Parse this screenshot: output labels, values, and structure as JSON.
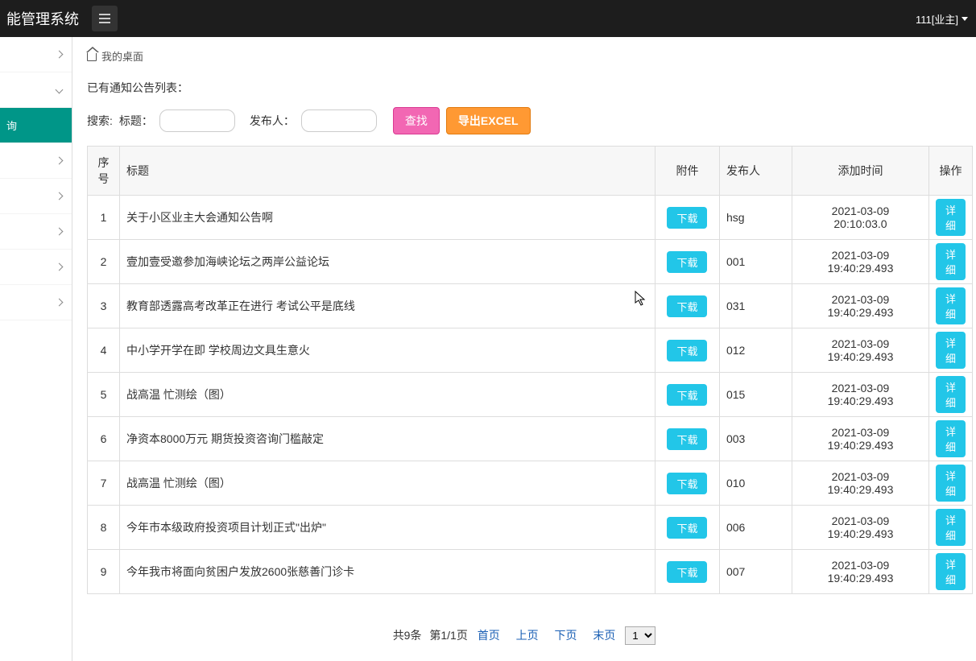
{
  "header": {
    "title": "能管理系统",
    "user": "111[业主]"
  },
  "sidebar": {
    "items": [
      {
        "label": "",
        "expand": "right"
      },
      {
        "label": "",
        "expand": "down"
      },
      {
        "label": "询",
        "active": true
      },
      {
        "label": "",
        "expand": "right"
      },
      {
        "label": "",
        "expand": "right"
      },
      {
        "label": "",
        "expand": "right"
      },
      {
        "label": "",
        "expand": "right"
      },
      {
        "label": "",
        "expand": "right"
      }
    ]
  },
  "breadcrumb": {
    "home": "我的桌面"
  },
  "list_title": "已有通知公告列表：",
  "search": {
    "prefix": "搜索:",
    "title_label": "标题：",
    "publisher_label": "发布人：",
    "search_btn": "查找",
    "export_btn": "导出EXCEL"
  },
  "table": {
    "headers": {
      "seq": "序号",
      "title": "标题",
      "attach": "附件",
      "publisher": "发布人",
      "time": "添加时间",
      "action": "操作"
    },
    "download_label": "下载",
    "detail_label": "详细",
    "rows": [
      {
        "seq": "1",
        "title": "关于小区业主大会通知公告啊",
        "publisher": "hsg",
        "time": "2021-03-09 20:10:03.0"
      },
      {
        "seq": "2",
        "title": "壹加壹受邀参加海峡论坛之两岸公益论坛",
        "publisher": "001",
        "time": "2021-03-09 19:40:29.493"
      },
      {
        "seq": "3",
        "title": "教育部透露高考改革正在进行 考试公平是底线",
        "publisher": "031",
        "time": "2021-03-09 19:40:29.493"
      },
      {
        "seq": "4",
        "title": "中小学开学在即 学校周边文具生意火",
        "publisher": "012",
        "time": "2021-03-09 19:40:29.493"
      },
      {
        "seq": "5",
        "title": "战高温 忙测绘（图）",
        "publisher": "015",
        "time": "2021-03-09 19:40:29.493"
      },
      {
        "seq": "6",
        "title": "净资本8000万元 期货投资咨询门槛敲定",
        "publisher": "003",
        "time": "2021-03-09 19:40:29.493"
      },
      {
        "seq": "7",
        "title": "战高温 忙测绘（图）",
        "publisher": "010",
        "time": "2021-03-09 19:40:29.493"
      },
      {
        "seq": "8",
        "title": "今年市本级政府投资项目计划正式\"出炉\"",
        "publisher": "006",
        "time": "2021-03-09 19:40:29.493"
      },
      {
        "seq": "9",
        "title": "今年我市将面向贫困户发放2600张慈善门诊卡",
        "publisher": "007",
        "time": "2021-03-09 19:40:29.493"
      }
    ]
  },
  "pagination": {
    "total": "共9条",
    "page": "第1/1页",
    "first": "首页",
    "prev": "上页",
    "next": "下页",
    "last": "末页",
    "select": "1"
  }
}
